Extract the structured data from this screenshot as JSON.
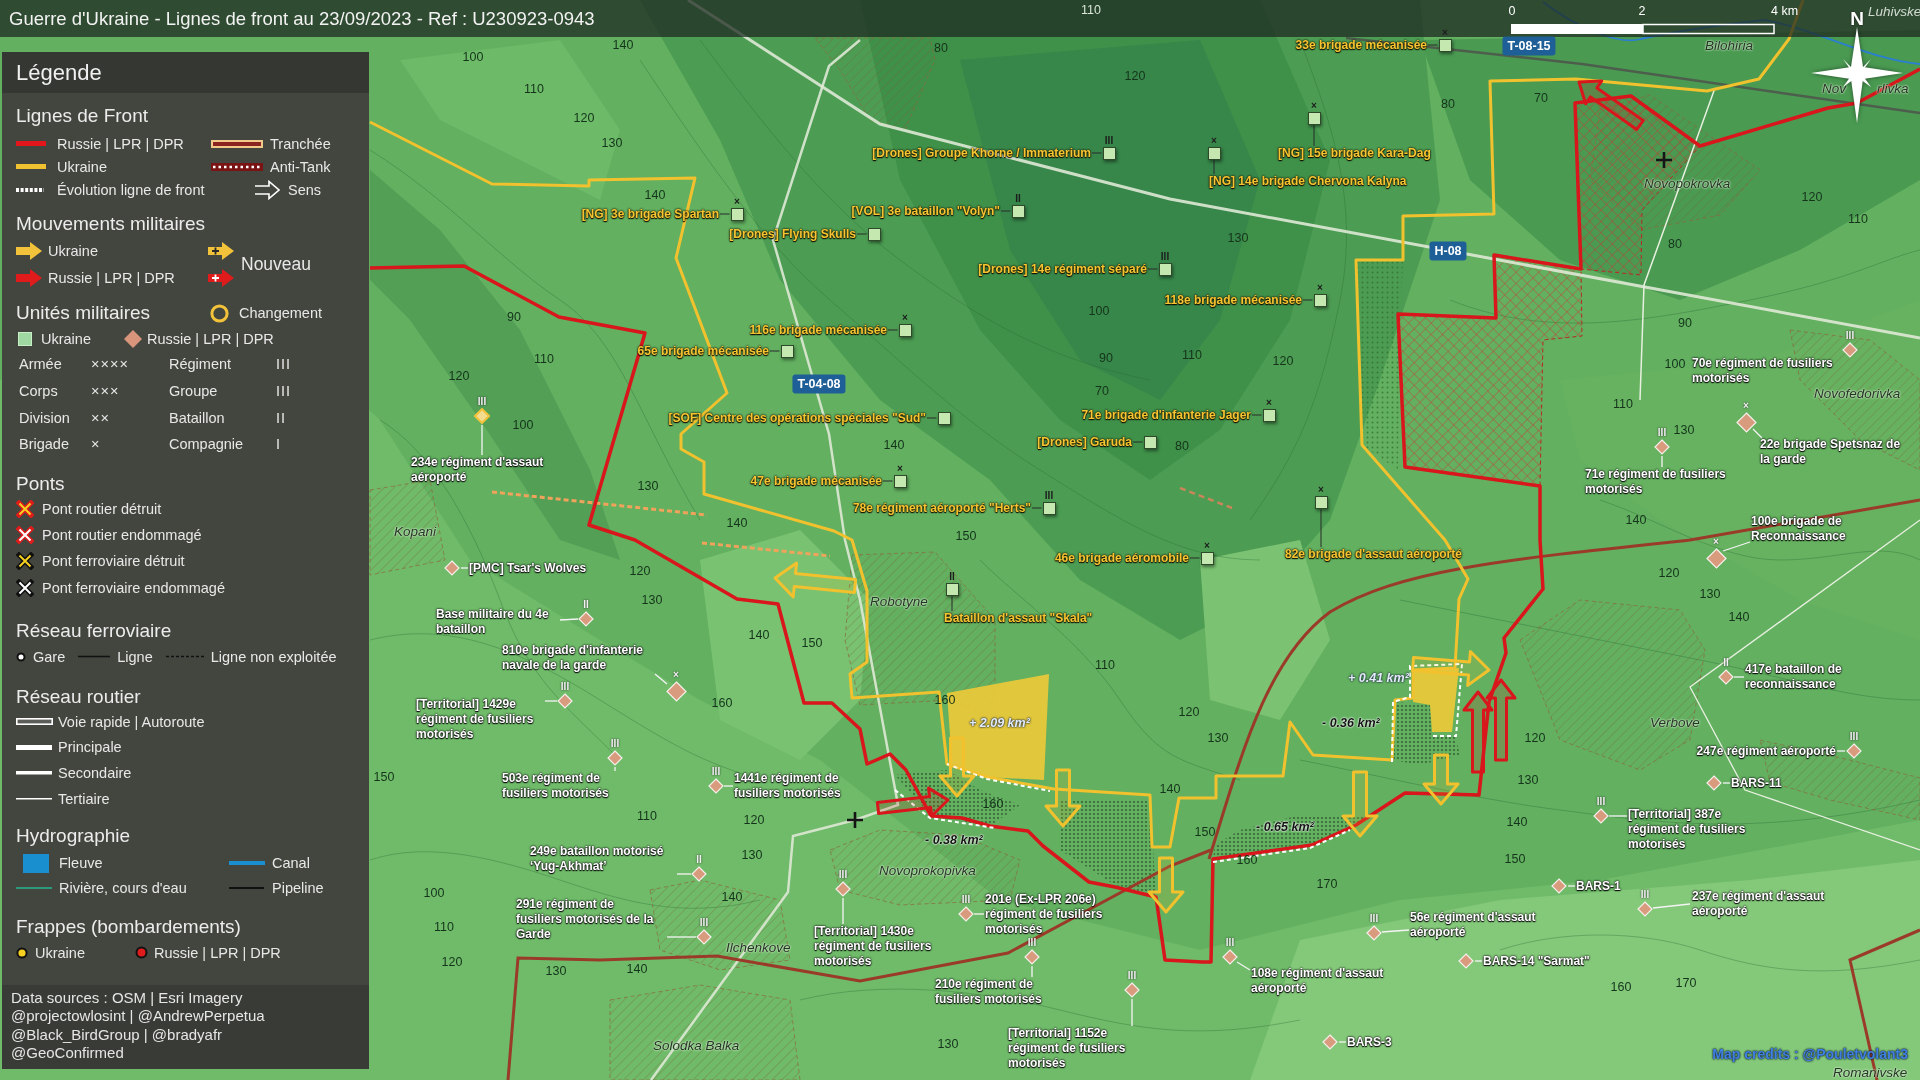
{
  "title": "Guerre d'Ukraine - Lignes de front au 23/09/2023 - Ref : U230923-0943",
  "scale_bar": {
    "ticks": [
      "0",
      "2",
      "4 km"
    ]
  },
  "compass": {
    "label": "N"
  },
  "legend": {
    "title": "Légende",
    "sections": [
      {
        "kind": "front-lines",
        "title": "Lignes de Front",
        "items": [
          {
            "kind": "russia-line",
            "label": "Russie | LPR | DPR"
          },
          {
            "kind": "trench",
            "label": "Tranchée"
          },
          {
            "kind": "ukraine-line",
            "label": "Ukraine"
          },
          {
            "kind": "anti-tank",
            "label": "Anti-Tank"
          },
          {
            "kind": "evolution-line",
            "label": "Évolution ligne de front"
          },
          {
            "kind": "direction",
            "label": "Sens"
          }
        ]
      },
      {
        "kind": "movements",
        "title": "Mouvements militaires",
        "items": [
          {
            "kind": "ukraine-arrow",
            "label": "Ukraine"
          },
          {
            "kind": "russia-arrow",
            "label": "Russie | LPR | DPR"
          }
        ],
        "new_label": "Nouveau"
      },
      {
        "kind": "units",
        "title": "Unités militaires",
        "change_label": "Changement",
        "items": [
          {
            "kind": "ukraine-unit",
            "label": "Ukraine"
          },
          {
            "kind": "russia-unit",
            "label": "Russie | LPR | DPR"
          }
        ],
        "echelons": [
          {
            "name": "Armée",
            "mark": "××××"
          },
          {
            "name": "Régiment",
            "mark": "III"
          },
          {
            "name": "Corps",
            "mark": "×××"
          },
          {
            "name": "Groupe",
            "mark": "III"
          },
          {
            "name": "Division",
            "mark": "××"
          },
          {
            "name": "Bataillon",
            "mark": "II"
          },
          {
            "name": "Brigade",
            "mark": "×"
          },
          {
            "name": "Compagnie",
            "mark": "I"
          }
        ]
      },
      {
        "kind": "bridges",
        "title": "Ponts",
        "items": [
          {
            "kind": "road-bridge-destroyed",
            "label": "Pont routier détruit"
          },
          {
            "kind": "road-bridge-damaged",
            "label": "Pont routier endommagé"
          },
          {
            "kind": "rail-bridge-destroyed",
            "label": "Pont ferroviaire détruit"
          },
          {
            "kind": "rail-bridge-damaged",
            "label": "Pont ferroviaire endommagé"
          }
        ]
      },
      {
        "kind": "railway",
        "title": "Réseau ferroviaire",
        "items": [
          {
            "kind": "station",
            "label": "Gare"
          },
          {
            "kind": "rail-line",
            "label": "Ligne"
          },
          {
            "kind": "rail-unused",
            "label": "Ligne non exploitée"
          }
        ]
      },
      {
        "kind": "roads",
        "title": "Réseau routier",
        "items": [
          {
            "kind": "highway",
            "label": "Voie rapide | Autoroute"
          },
          {
            "kind": "primary-road",
            "label": "Principale"
          },
          {
            "kind": "secondary-road",
            "label": "Secondaire"
          },
          {
            "kind": "tertiary-road",
            "label": "Tertiaire"
          }
        ]
      },
      {
        "kind": "hydrography",
        "title": "Hydrographie",
        "items": [
          {
            "kind": "river",
            "label": "Fleuve"
          },
          {
            "kind": "canal",
            "label": "Canal"
          },
          {
            "kind": "stream",
            "label": "Rivière, cours d'eau"
          },
          {
            "kind": "pipeline",
            "label": "Pipeline"
          }
        ]
      },
      {
        "kind": "strikes",
        "title": "Frappes (bombardements)",
        "items": [
          {
            "kind": "ukraine-strike",
            "label": "Ukraine"
          },
          {
            "kind": "russia-strike",
            "label": "Russie | LPR | DPR"
          }
        ]
      }
    ],
    "sources": [
      "Data sources : OSM | Esri Imagery",
      "@projectowlosint | @AndrewPerpetua",
      "@Black_BirdGroup | @bradyafr",
      "@GeoConfirmed"
    ]
  },
  "map": {
    "units": [
      {
        "kind": "ukraine",
        "echelon": "×",
        "lines": [
          "33e brigade mécanisée"
        ],
        "changed": false
      },
      {
        "kind": "ukraine",
        "echelon": "III",
        "lines": [
          "[Drones] Groupe Khorne / Immaterium"
        ],
        "changed": false
      },
      {
        "kind": "ukraine",
        "echelon": "×",
        "lines": [
          "[NG] 15e brigade Kara-Dag"
        ],
        "changed": false
      },
      {
        "kind": "ukraine",
        "echelon": "×",
        "lines": [
          "[NG] 14e brigade Chervona Kalyna"
        ],
        "changed": false
      },
      {
        "kind": "ukraine",
        "echelon": "×",
        "lines": [
          "[NG] 3e brigade Spartan"
        ],
        "changed": false
      },
      {
        "kind": "ukraine",
        "echelon": "II",
        "lines": [
          "[VOL] 3e bataillon \"Volyn\""
        ],
        "changed": false
      },
      {
        "kind": "ukraine",
        "lines": [
          "[Drones] Flying Skulls"
        ],
        "changed": false
      },
      {
        "kind": "ukraine",
        "echelon": "III",
        "lines": [
          "[Drones] 14e régiment séparé"
        ],
        "changed": false
      },
      {
        "kind": "ukraine",
        "echelon": "×",
        "lines": [
          "118e brigade mécanisée"
        ],
        "changed": false
      },
      {
        "kind": "ukraine",
        "echelon": "×",
        "lines": [
          "116e brigade mécanisée"
        ],
        "changed": false
      },
      {
        "kind": "ukraine",
        "lines": [
          "65e brigade mécanisée"
        ],
        "changed": false
      },
      {
        "kind": "russia",
        "echelon": "III",
        "lines": [
          "70e régiment de fusiliers",
          "motorisés"
        ],
        "changed": false
      },
      {
        "kind": "ukraine",
        "lines": [
          "[SOF] Centre des opérations spéciales \"Sud\""
        ],
        "changed": false
      },
      {
        "kind": "ukraine",
        "echelon": "×",
        "lines": [
          "71e brigade d'infanterie Jager"
        ],
        "changed": false
      },
      {
        "kind": "ukraine",
        "lines": [
          "[Drones] Garuda"
        ],
        "changed": false
      },
      {
        "kind": "russia",
        "echelon": "×",
        "lines": [
          "22e brigade Spetsnaz de",
          "la garde"
        ],
        "changed": false
      },
      {
        "kind": "russia",
        "echelon": "III",
        "lines": [
          "234e régiment d'assaut",
          "aéroporté"
        ],
        "changed": true
      },
      {
        "kind": "ukraine",
        "echelon": "×",
        "lines": [
          "47e brigade mécanisée"
        ],
        "changed": false
      },
      {
        "kind": "russia",
        "echelon": "III",
        "lines": [
          "71e régiment de fusiliers",
          "motorisés"
        ],
        "changed": false
      },
      {
        "kind": "ukraine",
        "echelon": "III",
        "lines": [
          "78e régiment aéroporté \"Herts\""
        ],
        "changed": false
      },
      {
        "kind": "russia",
        "echelon": "×",
        "lines": [
          "100e brigade de",
          "Reconnaissance"
        ],
        "changed": false
      },
      {
        "kind": "ukraine",
        "echelon": "×",
        "lines": [
          "46e brigade aéromobile"
        ],
        "changed": false
      },
      {
        "kind": "ukraine",
        "echelon": "×",
        "lines": [
          "82e brigade d'assaut aéroporté"
        ],
        "changed": false
      },
      {
        "kind": "russia",
        "lines": [
          "[PMC] Tsar's Wolves"
        ],
        "changed": false
      },
      {
        "kind": "russia",
        "echelon": "II",
        "lines": [
          "Base militaire du 4e",
          "bataillon"
        ],
        "changed": false
      },
      {
        "kind": "ukraine",
        "echelon": "II",
        "lines": [
          "Bataillon d'assaut \"Skala\""
        ],
        "changed": false
      },
      {
        "kind": "russia",
        "echelon": "×",
        "lines": [
          "810e brigade d'infanterie",
          "navale de la garde"
        ],
        "changed": false
      },
      {
        "kind": "russia",
        "echelon": "II",
        "lines": [
          "417e bataillon de",
          "reconnaissance"
        ],
        "changed": false
      },
      {
        "kind": "russia",
        "echelon": "III",
        "lines": [
          "[Territorial] 1429e",
          "régiment de fusiliers",
          "motorisés"
        ],
        "changed": false
      },
      {
        "kind": "russia",
        "echelon": "III",
        "lines": [
          "247e régiment aéroporté"
        ],
        "changed": false
      },
      {
        "kind": "russia",
        "echelon": "III",
        "lines": [
          "503e régiment de",
          "fusiliers motorisés"
        ],
        "changed": false
      },
      {
        "kind": "russia",
        "echelon": "III",
        "lines": [
          "1441e régiment de",
          "fusiliers motorisés"
        ],
        "changed": false
      },
      {
        "kind": "russia",
        "lines": [
          "BARS-11"
        ],
        "changed": false
      },
      {
        "kind": "russia",
        "echelon": "III",
        "lines": [
          "[Territorial] 387e",
          "régiment de fusiliers",
          "motorisés"
        ],
        "changed": false
      },
      {
        "kind": "russia",
        "echelon": "II",
        "lines": [
          "249e bataillon motorisé",
          "‘Yug-Akhmat’"
        ],
        "changed": false
      },
      {
        "kind": "russia",
        "lines": [
          "BARS-1"
        ],
        "changed": false
      },
      {
        "kind": "russia",
        "echelon": "III",
        "lines": [
          "291e régiment de",
          "fusiliers motorisés de la",
          "Garde"
        ],
        "changed": false
      },
      {
        "kind": "russia",
        "echelon": "III",
        "lines": [
          "201e (Ex-LPR 206e)",
          "régiment de fusiliers",
          "motorisés"
        ],
        "changed": false
      },
      {
        "kind": "russia",
        "echelon": "III",
        "lines": [
          "237e régiment d'assaut",
          "aéroporté"
        ],
        "changed": false
      },
      {
        "kind": "russia",
        "echelon": "III",
        "lines": [
          "[Territorial] 1430e",
          "régiment de fusiliers",
          "motorisés"
        ],
        "changed": false
      },
      {
        "kind": "russia",
        "echelon": "III",
        "lines": [
          "56e régiment d'assaut",
          "aéroporté"
        ],
        "changed": false
      },
      {
        "kind": "russia",
        "lines": [
          "BARS-14 \"Sarmat\""
        ],
        "changed": false
      },
      {
        "kind": "russia",
        "echelon": "III",
        "lines": [
          "210e régiment de",
          "fusiliers motorisés"
        ],
        "changed": false
      },
      {
        "kind": "russia",
        "echelon": "III",
        "lines": [
          "108e régiment d'assaut",
          "aéroporté"
        ],
        "changed": false
      },
      {
        "kind": "russia",
        "echelon": "III",
        "lines": [
          "[Territorial] 1152e",
          "régiment de fusiliers",
          "motorisés"
        ],
        "changed": false
      },
      {
        "kind": "russia",
        "lines": [
          "BARS-3"
        ],
        "changed": false
      }
    ],
    "places": [
      "Luhivske",
      "Bilohiria",
      "Nov",
      "rlivka",
      "Novopokrovka",
      "Novofedorivka",
      "Kopani",
      "Robotyne",
      "Verbove",
      "Novoprokopivka",
      "Ilchenkove",
      "Solodka Balka",
      "Romanivske"
    ],
    "road_numbers": [
      "T-08-15",
      "H-08",
      "T-04-08"
    ],
    "area_changes": [
      {
        "kind": "gain",
        "text": "+ 0.41 km²"
      },
      {
        "kind": "gain",
        "text": "+ 2.09 km²"
      },
      {
        "kind": "loss",
        "text": "- 0.36 km²"
      },
      {
        "kind": "loss",
        "text": "- 0.65 km²"
      },
      {
        "kind": "loss",
        "text": "- 0.38 km²"
      }
    ],
    "elevations": [
      "110",
      "140",
      "80",
      "100",
      "120",
      "110",
      "80",
      "70",
      "120",
      "130",
      "140",
      "120",
      "110",
      "130",
      "80",
      "90",
      "100",
      "90",
      "110",
      "90",
      "110",
      "120",
      "100",
      "120",
      "70",
      "110",
      "100",
      "130",
      "140",
      "80",
      "130",
      "140",
      "140",
      "150",
      "120",
      "120",
      "130",
      "130",
      "140",
      "140",
      "150",
      "110",
      "160",
      "160",
      "120",
      "130",
      "120",
      "150",
      "130",
      "140",
      "160",
      "110",
      "120",
      "140",
      "150",
      "130",
      "160",
      "150",
      "170",
      "100",
      "140",
      "110",
      "120",
      "130",
      "140",
      "160",
      "170",
      "130"
    ],
    "credits": "Map credits : @Pouletvolant3"
  }
}
